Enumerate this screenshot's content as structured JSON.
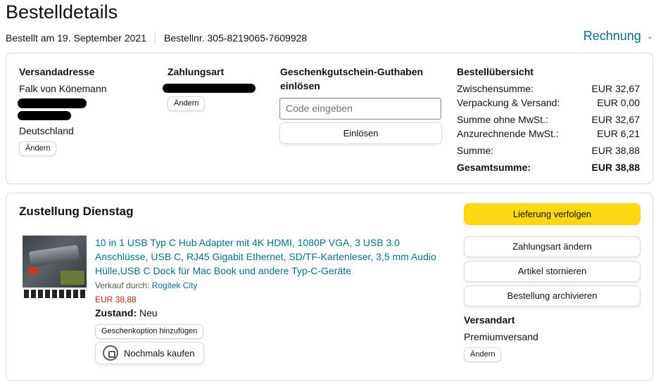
{
  "header": {
    "title": "Bestelldetails",
    "ordered_on": "Bestellt am 19. September 2021",
    "order_number": "Bestellnr. 305-8219065-7609928",
    "invoice_label": "Rechnung",
    "invoice_icon": "chevron-down-icon"
  },
  "shipping_address": {
    "title": "Versandadresse",
    "name": "Falk von Könemann",
    "country": "Deutschland",
    "change_label": "Ändern"
  },
  "payment": {
    "title": "Zahlungsart",
    "change_label": "Ändern"
  },
  "gift_card": {
    "title_line1": "Geschenkgutschein-Guthaben",
    "title_line2": "einlösen",
    "placeholder": "Code eingeben",
    "redeem_label": "Einlösen"
  },
  "summary": {
    "title": "Bestellübersicht",
    "rows": [
      {
        "label": "Zwischensumme:",
        "value": "EUR 32,67"
      },
      {
        "label": "Verpackung & Versand:",
        "value": "EUR 0,00"
      },
      {
        "label": "Summe ohne MwSt.:",
        "value": "EUR 32,67"
      },
      {
        "label": "Anzurechnende MwSt.:",
        "value": "EUR 6,21"
      },
      {
        "label": "Summe:",
        "value": "EUR 38,88"
      },
      {
        "label": "Gesamtsumme:",
        "value": "EUR 38,88"
      }
    ]
  },
  "delivery": {
    "title": "Zustellung Dienstag",
    "product_title": "10 in 1 USB Typ C Hub Adapter mit 4K HDMI, 1080P VGA, 3 USB 3.0 Anschlüsse, USB C, RJ45 Gigabit Ethernet, SD/TF-Kartenleser, 3,5 mm Audio Hülle,USB C Dock für Mac Book und andere Typ-C-Geräte",
    "seller_prefix": "Verkauf durch: ",
    "seller_name": "Rogitek City",
    "price": "EUR 38,88",
    "condition_label": "Zustand:",
    "condition_value": " Neu",
    "gift_option_label": "Geschenkoption hinzufügen",
    "rebuy_label": "Nochmals kaufen"
  },
  "actions": {
    "track": "Lieferung verfolgen",
    "change_payment": "Zahlungsart ändern",
    "cancel": "Artikel stornieren",
    "archive": "Bestellung archivieren"
  },
  "shipping_method": {
    "title": "Versandart",
    "value": "Premiumversand",
    "change_label": "Ändern"
  },
  "colors": {
    "link": "#007185",
    "price": "#b12704",
    "primary_button": "#ffd814"
  }
}
